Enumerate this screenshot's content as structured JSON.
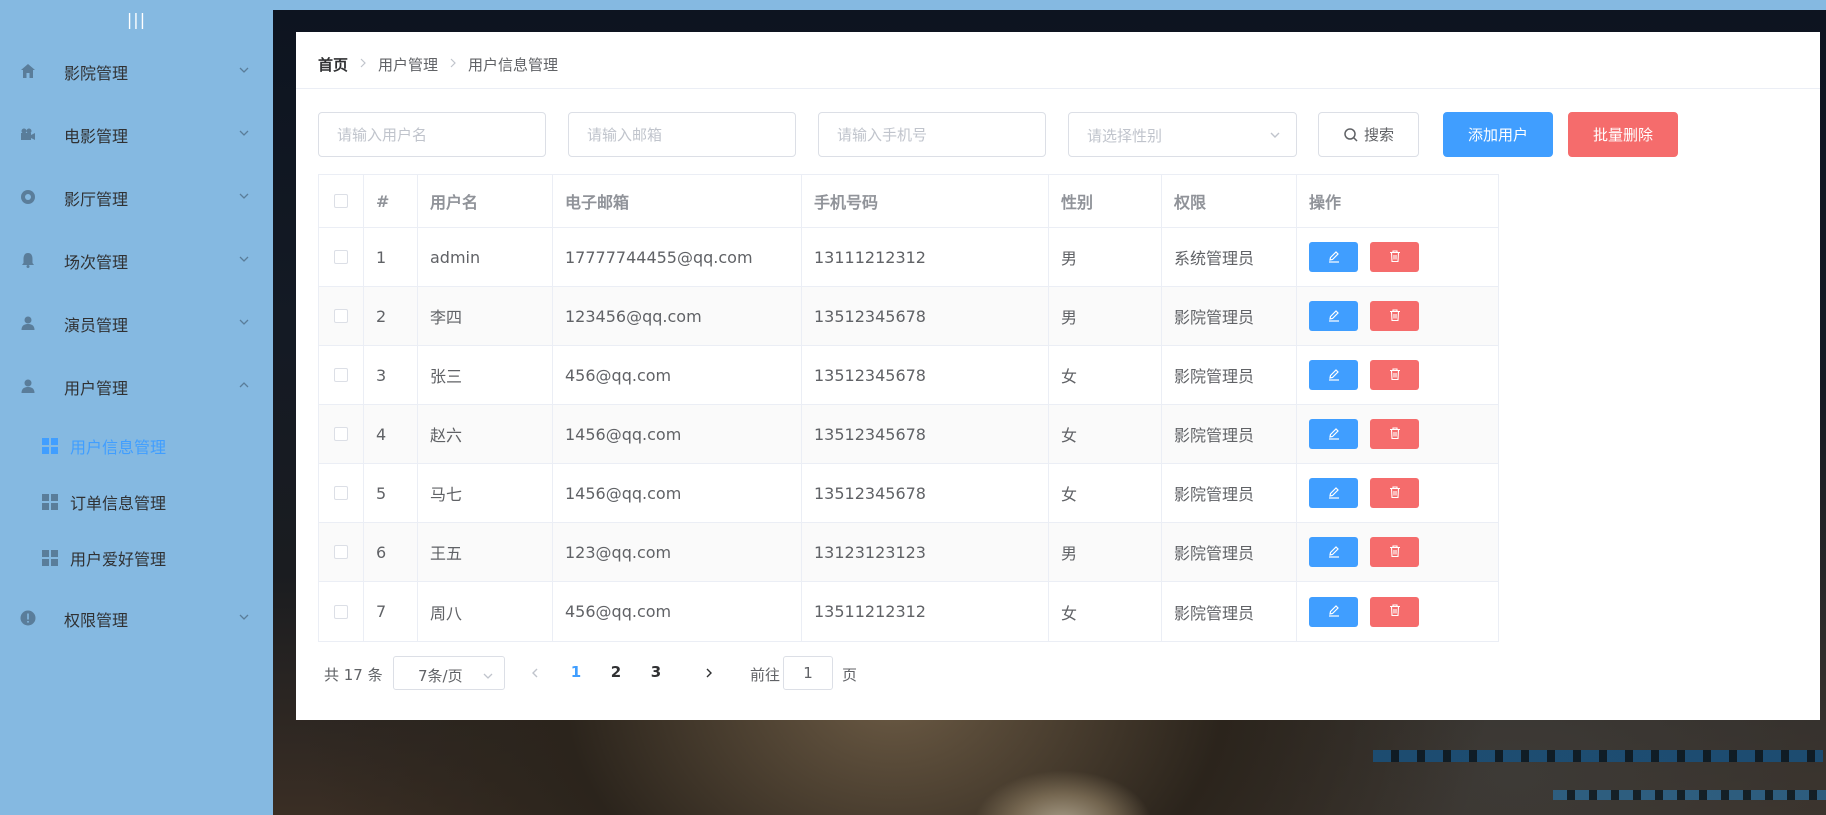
{
  "sidebar": {
    "collapse_symbol": "|||",
    "menus": [
      {
        "label": "影院管理",
        "icon": "home-icon",
        "expanded": false
      },
      {
        "label": "电影管理",
        "icon": "video-camera-icon",
        "expanded": false
      },
      {
        "label": "影厅管理",
        "icon": "aperture-icon",
        "expanded": false
      },
      {
        "label": "场次管理",
        "icon": "bell-icon",
        "expanded": false
      },
      {
        "label": "演员管理",
        "icon": "user-icon",
        "expanded": false
      },
      {
        "label": "用户管理",
        "icon": "user-icon",
        "expanded": true
      },
      {
        "label": "权限管理",
        "icon": "warning-circle-icon",
        "expanded": false
      }
    ],
    "submenus": [
      {
        "label": "用户信息管理",
        "active": true
      },
      {
        "label": "订单信息管理",
        "active": false
      },
      {
        "label": "用户爱好管理",
        "active": false
      }
    ]
  },
  "breadcrumb": [
    "首页",
    "用户管理",
    "用户信息管理"
  ],
  "filters": {
    "username_placeholder": "请输入用户名",
    "email_placeholder": "请输入邮箱",
    "phone_placeholder": "请输入手机号",
    "gender_placeholder": "请选择性别"
  },
  "buttons": {
    "search": "搜索",
    "add_user": "添加用户",
    "batch_delete": "批量删除"
  },
  "table": {
    "headers": [
      "#",
      "用户名",
      "电子邮箱",
      "手机号码",
      "性别",
      "权限",
      "操作"
    ],
    "rows": [
      {
        "no": "1",
        "username": "admin",
        "email": "17777744455@qq.com",
        "phone": "13111212312",
        "gender": "男",
        "role": "系统管理员"
      },
      {
        "no": "2",
        "username": "李四",
        "email": "123456@qq.com",
        "phone": "13512345678",
        "gender": "男",
        "role": "影院管理员"
      },
      {
        "no": "3",
        "username": "张三",
        "email": "456@qq.com",
        "phone": "13512345678",
        "gender": "女",
        "role": "影院管理员"
      },
      {
        "no": "4",
        "username": "赵六",
        "email": "1456@qq.com",
        "phone": "13512345678",
        "gender": "女",
        "role": "影院管理员"
      },
      {
        "no": "5",
        "username": "马七",
        "email": "1456@qq.com",
        "phone": "13512345678",
        "gender": "女",
        "role": "影院管理员"
      },
      {
        "no": "6",
        "username": "王五",
        "email": "123@qq.com",
        "phone": "13123123123",
        "gender": "男",
        "role": "影院管理员"
      },
      {
        "no": "7",
        "username": "周八",
        "email": "456@qq.com",
        "phone": "13511212312",
        "gender": "女",
        "role": "影院管理员"
      }
    ]
  },
  "pagination": {
    "total_text": "共 17 条",
    "page_size": "7条/页",
    "pages": [
      "1",
      "2",
      "3"
    ],
    "current_page": "1",
    "goto_label": "前往",
    "goto_value": "1",
    "goto_suffix": "页"
  },
  "colors": {
    "sidebar_bg": "#85b9e1",
    "primary": "#409eff",
    "danger": "#f56c6c"
  }
}
